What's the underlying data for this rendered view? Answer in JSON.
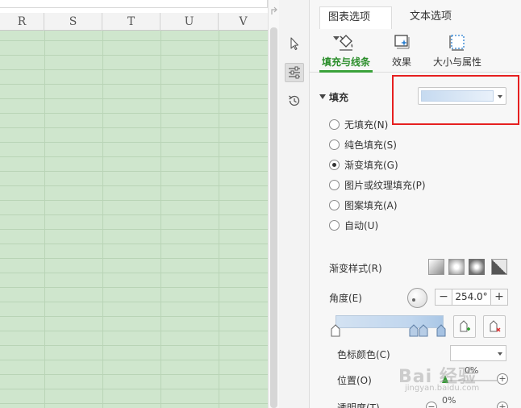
{
  "spreadsheet": {
    "columns": [
      "R",
      "S",
      "T",
      "U",
      "V"
    ],
    "cell_fill_color": "#cfe6cd"
  },
  "toolstrip": {
    "items": [
      {
        "icon": "cursor-icon"
      },
      {
        "icon": "properties-sliders-icon"
      },
      {
        "icon": "history-icon"
      }
    ]
  },
  "pane": {
    "tabs": [
      {
        "label": "图表选项"
      },
      {
        "label": "文本选项"
      }
    ],
    "sub_tabs": [
      {
        "label": "填充与线条",
        "icon": "fill-bucket-icon"
      },
      {
        "label": "效果",
        "icon": "effects-icon"
      },
      {
        "label": "大小与属性",
        "icon": "size-properties-icon"
      }
    ],
    "fill": {
      "section_label": "填充",
      "swatch_color": "#c6daf0",
      "options": [
        {
          "label": "无填充(N)",
          "checked": false
        },
        {
          "label": "纯色填充(S)",
          "checked": false
        },
        {
          "label": "渐变填充(G)",
          "checked": true
        },
        {
          "label": "图片或纹理填充(P)",
          "checked": false
        },
        {
          "label": "图案填充(A)",
          "checked": false
        },
        {
          "label": "自动(U)",
          "checked": false
        }
      ]
    },
    "gradient": {
      "style_label": "渐变样式(R)",
      "angle_label": "角度(E)",
      "angle_value": "254.0°",
      "minus": "−",
      "plus": "+",
      "stop_color_label": "色标颜色(C)",
      "position_label": "位置(O)",
      "position_value": "0%",
      "transparency_label": "透明度(T)",
      "transparency_value": "0%"
    },
    "accent_color": "#3aa23a",
    "highlight_color": "#e62020"
  },
  "watermark": {
    "text": "Bai 经验",
    "sub": "jingyan.baidu.com"
  }
}
